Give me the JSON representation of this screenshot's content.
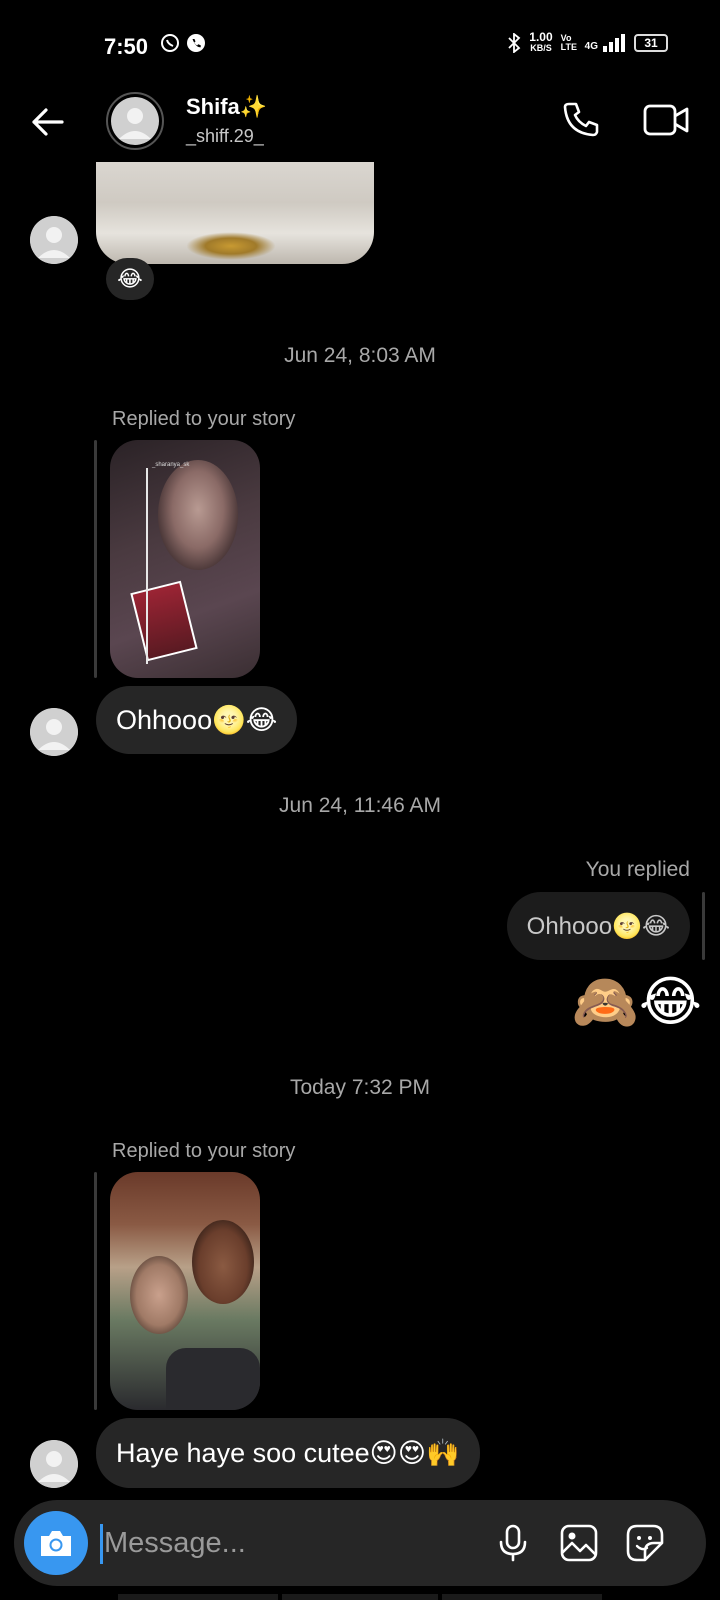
{
  "status_bar": {
    "time": "7:50",
    "left_icons": [
      "whatsapp-icon",
      "phone-call-icon"
    ],
    "network_speed_value": "1.00",
    "network_speed_unit": "KB/S",
    "volte": "Vo LTE",
    "network": "4G",
    "battery": "31"
  },
  "header": {
    "name": "Shifa✨",
    "username": "_shiff.29_",
    "back_icon": "arrow-left-icon",
    "call_icon": "phone-icon",
    "video_icon": "video-camera-icon"
  },
  "messages": {
    "top_photo_reaction": "😂",
    "timestamp_1": "Jun 24, 8:03 AM",
    "replied_label_1": "Replied to your story",
    "story1_username": "_sharanya_sk",
    "message_1": "Ohhooo🌝😂",
    "timestamp_2": "Jun 24, 11:46 AM",
    "you_replied_label": "You replied",
    "your_reply_quote": "Ohhooo🌝😂",
    "your_message": "🙈😂",
    "timestamp_3": "Today 7:32 PM",
    "replied_label_2": "Replied to your story",
    "message_2": "Haye haye soo cutee😍😍🙌"
  },
  "composer": {
    "placeholder": "Message...",
    "camera_icon": "camera-icon",
    "mic_icon": "microphone-icon",
    "gallery_icon": "image-icon",
    "sticker_icon": "sticker-icon",
    "accent_color": "#3897f0"
  },
  "colors": {
    "background": "#000000",
    "bubble": "#262626",
    "muted_text": "#a8a8a8"
  }
}
